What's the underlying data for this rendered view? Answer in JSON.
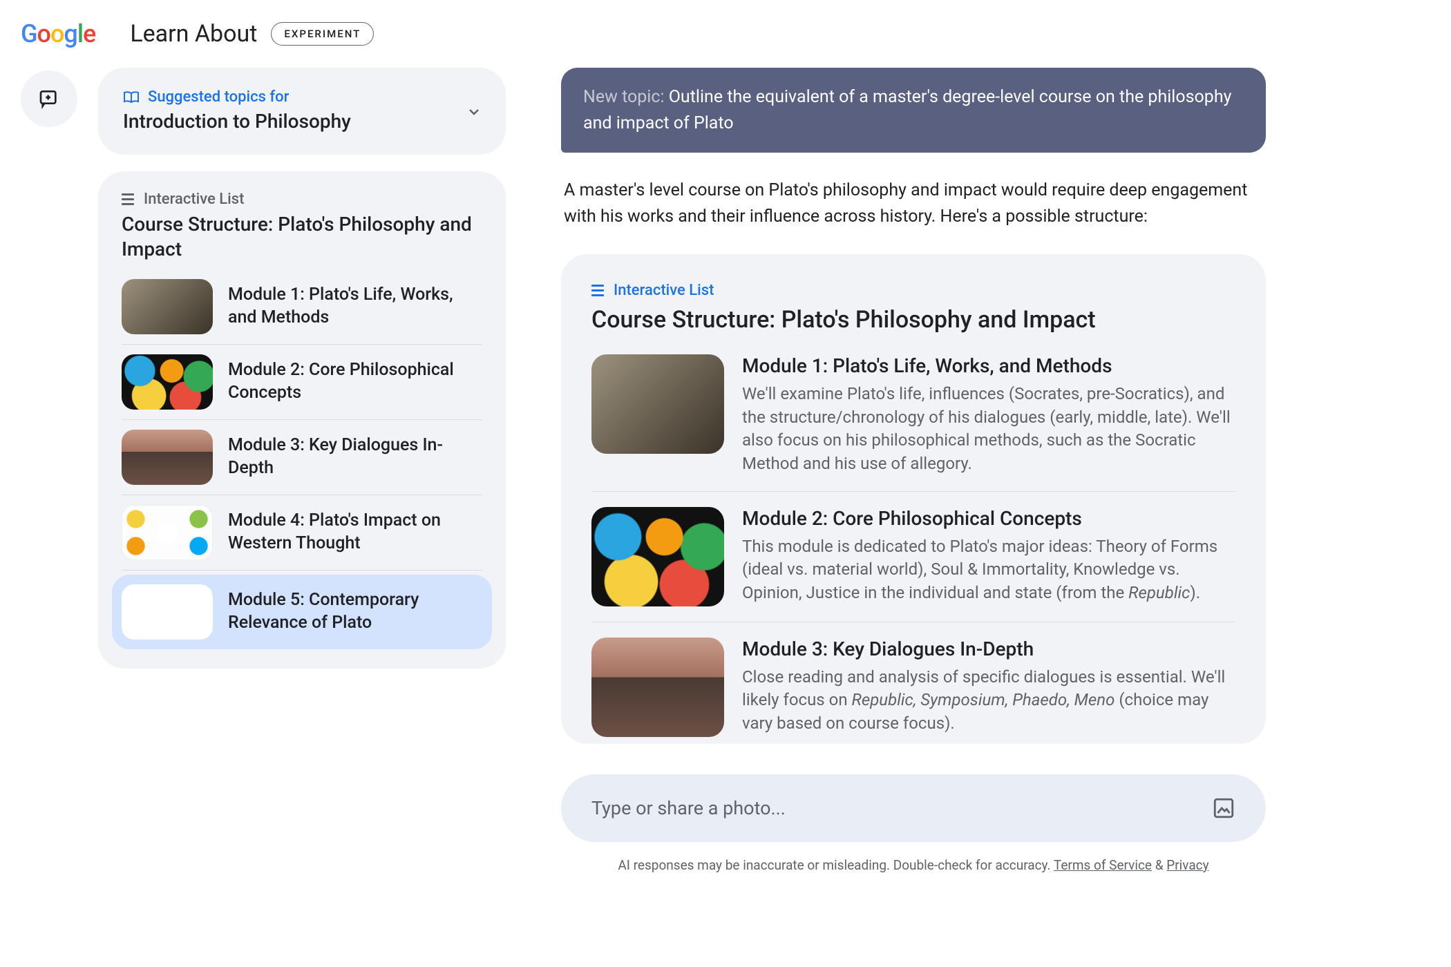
{
  "header": {
    "app_title": "Learn About",
    "badge": "EXPERIMENT"
  },
  "suggested": {
    "label": "Suggested topics for",
    "course": "Introduction to Philosophy"
  },
  "sidebar_list": {
    "label": "Interactive List",
    "title": "Course Structure: Plato's Philosophy and Impact",
    "items": [
      {
        "label": "Module 1: Plato's Life, Works, and Methods"
      },
      {
        "label": "Module 2: Core Philosophical Concepts"
      },
      {
        "label": "Module 3: Key Dialogues In-Depth"
      },
      {
        "label": "Module 4: Plato's Impact on Western Thought"
      },
      {
        "label": "Module 5: Contemporary Relevance of Plato"
      }
    ],
    "selected_index": 4
  },
  "topic_bubble": {
    "prefix": "New topic:",
    "text": "Outline the equivalent of a master's degree-level course on the philosophy and impact of Plato"
  },
  "intro": "A master's level course on Plato's philosophy and impact would require deep engagement with his works and their influence across history. Here's a possible structure:",
  "main_list": {
    "label": "Interactive List",
    "title": "Course Structure: Plato's Philosophy and Impact",
    "items": [
      {
        "title": "Module 1: Plato's Life, Works, and Methods",
        "desc_pre": "We'll examine Plato's life, influences (Socrates, pre-Socratics), and the structure/chronology of his dialogues (early, middle, late). We'll also focus on his philosophical methods, such as the Socratic Method and his use of allegory.",
        "desc_italic": "",
        "desc_post": ""
      },
      {
        "title": "Module 2: Core Philosophical Concepts",
        "desc_pre": "This module is dedicated to Plato's major ideas: Theory of Forms (ideal vs. material world), Soul & Immortality, Knowledge vs. Opinion, Justice in the individual and state (from the ",
        "desc_italic": "Republic",
        "desc_post": ")."
      },
      {
        "title": "Module 3: Key Dialogues In-Depth",
        "desc_pre": "Close reading and analysis of specific dialogues is essential. We'll likely focus on ",
        "desc_italic": "Republic, Symposium, Phaedo, Meno",
        "desc_post": " (choice may vary based on course focus)."
      }
    ]
  },
  "input": {
    "placeholder": "Type or share a photo..."
  },
  "disclaimer": {
    "text_pre": "AI responses may be inaccurate or misleading. Double-check for accuracy. ",
    "tos": "Terms of Service",
    "amp": " & ",
    "privacy": "Privacy"
  }
}
